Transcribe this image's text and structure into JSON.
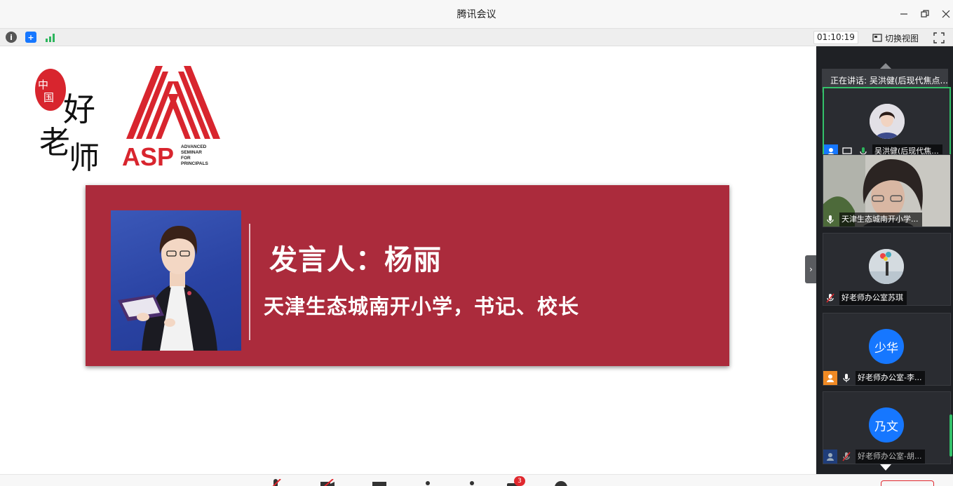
{
  "window": {
    "title": "腾讯会议"
  },
  "toolbar": {
    "timer": "01:10:19",
    "switch_view_label": "切换视图"
  },
  "slide": {
    "logo_cn_text": "中国好老师",
    "logo_asp": {
      "acronym": "ASP",
      "full": "ADVANCED SEMINAR FOR PRINCIPALS"
    },
    "speaker_line": "发言人：杨丽",
    "position_line": "天津生态城南开小学，书记、校长",
    "banner_color": "#ab2b3c"
  },
  "panel": {
    "speaking_now": "正在讲话: 吴洪健(后现代焦点...",
    "participants": [
      {
        "name": "吴洪健(后现代焦...",
        "avatar": "photo",
        "active": true,
        "mic": "on"
      },
      {
        "name": "天津生态城南开小学...",
        "avatar": "video",
        "active": false,
        "mic": "on"
      },
      {
        "name": "好老师办公室苏琪",
        "avatar": "photo",
        "active": false,
        "mic": "muted"
      },
      {
        "name": "好老师办公室-李...",
        "avatar": "少华",
        "avatar_color": "#1677ff",
        "active": false,
        "mic": "on"
      },
      {
        "name": "好老师办公室-胡...",
        "avatar": "乃文",
        "avatar_color": "#1677ff",
        "active": false,
        "mic": "muted"
      }
    ]
  },
  "bottombar": {
    "chat_badge": "3"
  },
  "colors": {
    "accent_green": "#33c26a",
    "accent_blue": "#1677ff",
    "end_red": "#e0282e"
  }
}
